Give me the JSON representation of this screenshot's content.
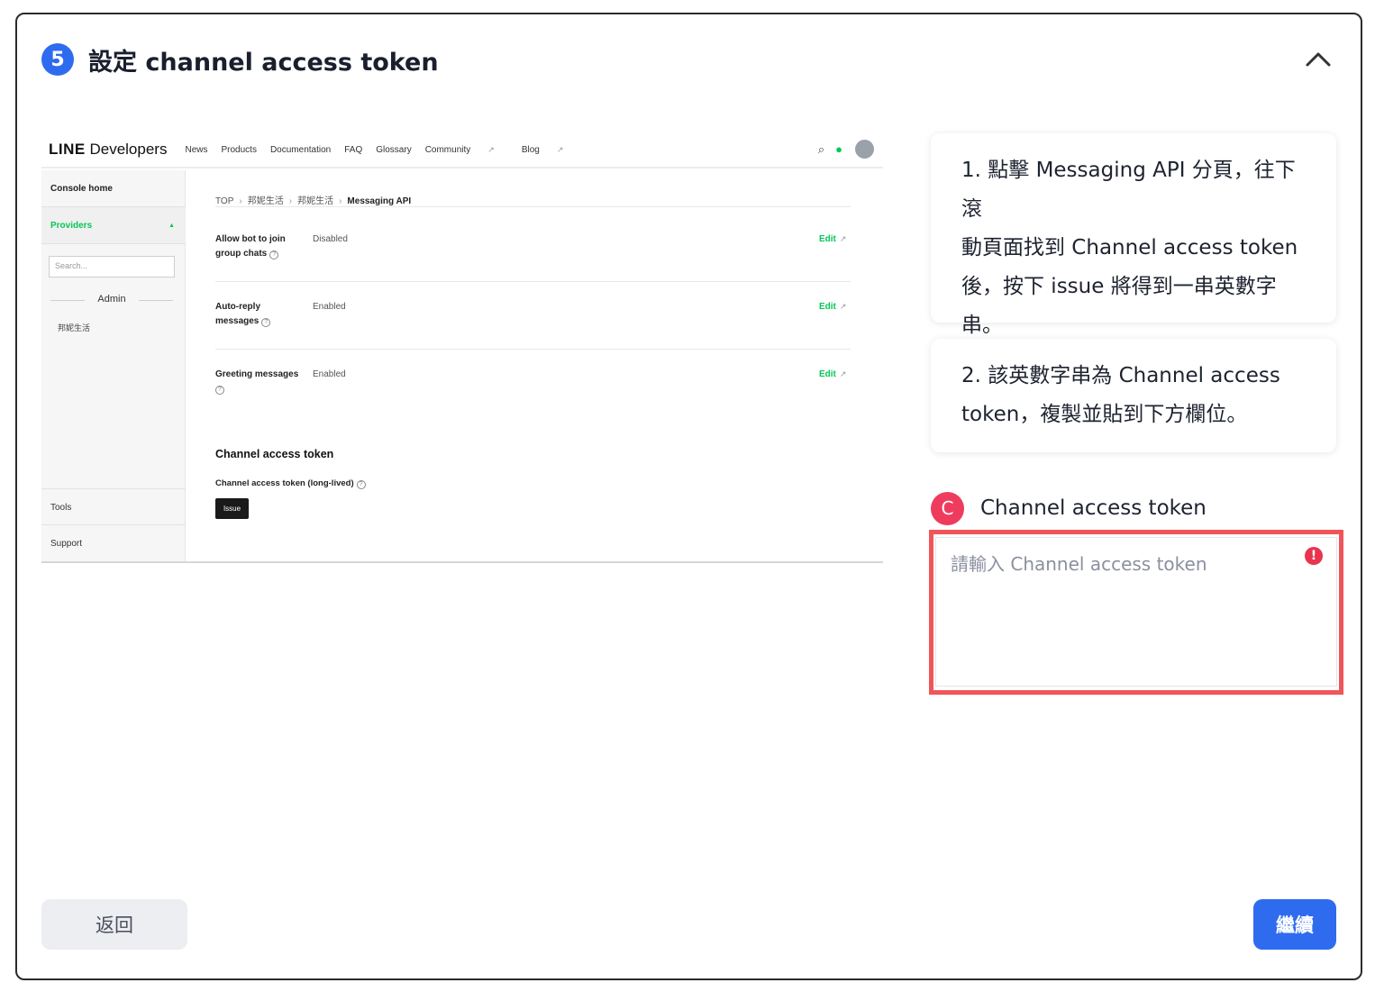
{
  "step": {
    "number": "5",
    "title": "設定 channel access token",
    "collapse_icon": "chevron-up-icon"
  },
  "line_console": {
    "logo_brand": "LINE",
    "logo_text": "Developers",
    "nav": [
      "News",
      "Products",
      "Documentation",
      "FAQ",
      "Glossary",
      "Community",
      "Blog"
    ],
    "sidebar": {
      "console_home": "Console home",
      "providers": "Providers",
      "search_placeholder": "Search...",
      "admin": "Admin",
      "provider_item": "邦妮生活",
      "tools": "Tools",
      "support": "Support"
    },
    "breadcrumb": [
      "TOP",
      "邦妮生活",
      "邦妮生活",
      "Messaging API"
    ],
    "settings": [
      {
        "label_line1": "Allow bot to join",
        "label_line2": "group chats",
        "value": "Disabled",
        "edit": "Edit"
      },
      {
        "label_line1": "Auto-reply",
        "label_line2": "messages",
        "value": "Enabled",
        "edit": "Edit"
      },
      {
        "label_line1": "Greeting messages",
        "label_line2": "",
        "value": "Enabled",
        "edit": "Edit"
      }
    ],
    "token_section_title": "Channel access token",
    "token_long_lived_label": "Channel access token (long-lived)",
    "issue_button": "Issue"
  },
  "instructions": {
    "step1_lines": [
      "1. 點擊 Messaging API 分頁，往下滾",
      "動頁面找到 Channel access token",
      "後，按下 issue 將得到一串英數字",
      "串。"
    ],
    "step2_lines": [
      "2. 該英數字串為 Channel access",
      "token，複製並貼到下方欄位。"
    ]
  },
  "field": {
    "badge": "C",
    "label": "Channel access token",
    "placeholder": "請輸入 Channel access token",
    "value": "",
    "error_icon": "!"
  },
  "buttons": {
    "back": "返回",
    "next": "繼續"
  },
  "colors": {
    "primary": "#2f6bef",
    "badge_red": "#ef3b5d",
    "highlight_red": "#f0555a",
    "line_green": "#06c755"
  }
}
